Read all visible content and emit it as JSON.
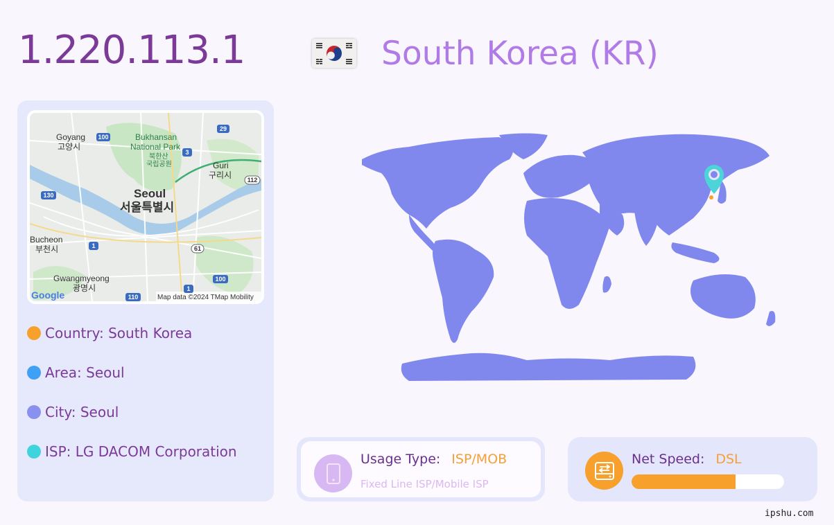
{
  "ip_address": "1.220.113.1",
  "country_title": "South Korea (KR)",
  "map_labels": {
    "goyang_en": "Goyang",
    "goyang_kr": "고양시",
    "bukhansan_1": "Bukhansan",
    "bukhansan_2": "National Park",
    "bukhansan_kr1": "북한산",
    "bukhansan_kr2": "국립공원",
    "guri_en": "Guri",
    "guri_kr": "구리시",
    "seoul_en": "Seoul",
    "seoul_kr": "서울특별시",
    "bucheon_en": "Bucheon",
    "bucheon_kr": "부천시",
    "gwangmyeong_en": "Gwangmyeong",
    "gwangmyeong_kr": "광명시",
    "attribution": "Map data ©2024 TMap Mobility",
    "google": "Google",
    "shields": [
      "100",
      "29",
      "3",
      "130",
      "112",
      "1",
      "61",
      "100",
      "1",
      "110"
    ]
  },
  "info": {
    "country": "Country: South Korea",
    "area": "Area: Seoul",
    "city": "City: Seoul",
    "isp": "ISP: LG DACOM Corporation"
  },
  "usage": {
    "label": "Usage Type:",
    "value": "ISP/MOB",
    "description": "Fixed Line ISP/Mobile ISP"
  },
  "speed": {
    "label": "Net Speed:",
    "value": "DSL",
    "progress": 0.68
  },
  "footer": "ipshu.com",
  "colors": {
    "ip": "#7b3a98",
    "country": "#b07be6",
    "panel": "#e6e9fb",
    "world": "#8088ee",
    "accent_orange": "#f7a02c",
    "pin": "#4cd4d8"
  },
  "dot_colors": {
    "country": "#f7a02c",
    "area": "#3fa1f4",
    "city": "#8a90ee",
    "isp": "#3fd4dc"
  },
  "icons": {
    "usage": "mobile-phone-icon",
    "speed": "hard-drive-transfer-icon",
    "pin": "location-pin-icon"
  }
}
